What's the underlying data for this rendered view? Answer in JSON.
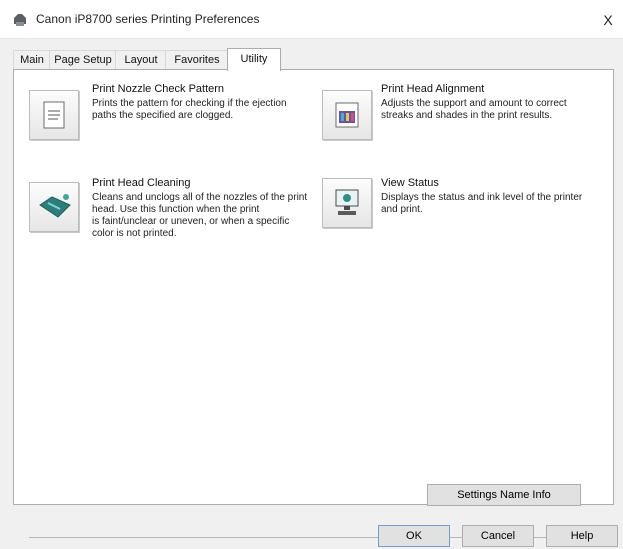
{
  "window": {
    "title": "Canon iP8700 series Printing Preferences",
    "close_glyph": "X"
  },
  "tabs": [
    {
      "label": "Main"
    },
    {
      "label": "Page Setup"
    },
    {
      "label": "Layout"
    },
    {
      "label": "Favorites"
    },
    {
      "label": "Utility"
    }
  ],
  "utility": {
    "items": [
      {
        "title": "Print Nozzle Check Pattern",
        "icon": "nozzle-check-icon",
        "desc_lines": [
          "Prints the pattern for checking if the ejection",
          "paths the specified are clogged."
        ]
      },
      {
        "title": "Print Head Alignment",
        "icon": "print-head-alignment-icon",
        "desc_lines": [
          "Adjusts the support and amount to correct",
          "streaks and shades in the print results."
        ]
      },
      {
        "title": "Print Head Cleaning",
        "icon": "print-head-cleaning-icon",
        "desc_lines": [
          "Cleans and unclogs all of the nozzles of the print",
          "head. Use this function when the print",
          "is faint/unclear or uneven, or when a specific",
          "color is not printed."
        ]
      },
      {
        "title": "View Status",
        "icon": "printer-status-icon",
        "desc_lines": [
          "Displays the status and ink level of the printer",
          "and print."
        ]
      }
    ]
  },
  "buttons": {
    "settings_name": "Settings Name Info",
    "ok": "OK",
    "cancel": "Cancel",
    "help": "Help"
  },
  "colors": {
    "panel_bg": "#ffffff",
    "window_bg": "#f0f0f0",
    "default_button_border": "#6d9fd8"
  }
}
